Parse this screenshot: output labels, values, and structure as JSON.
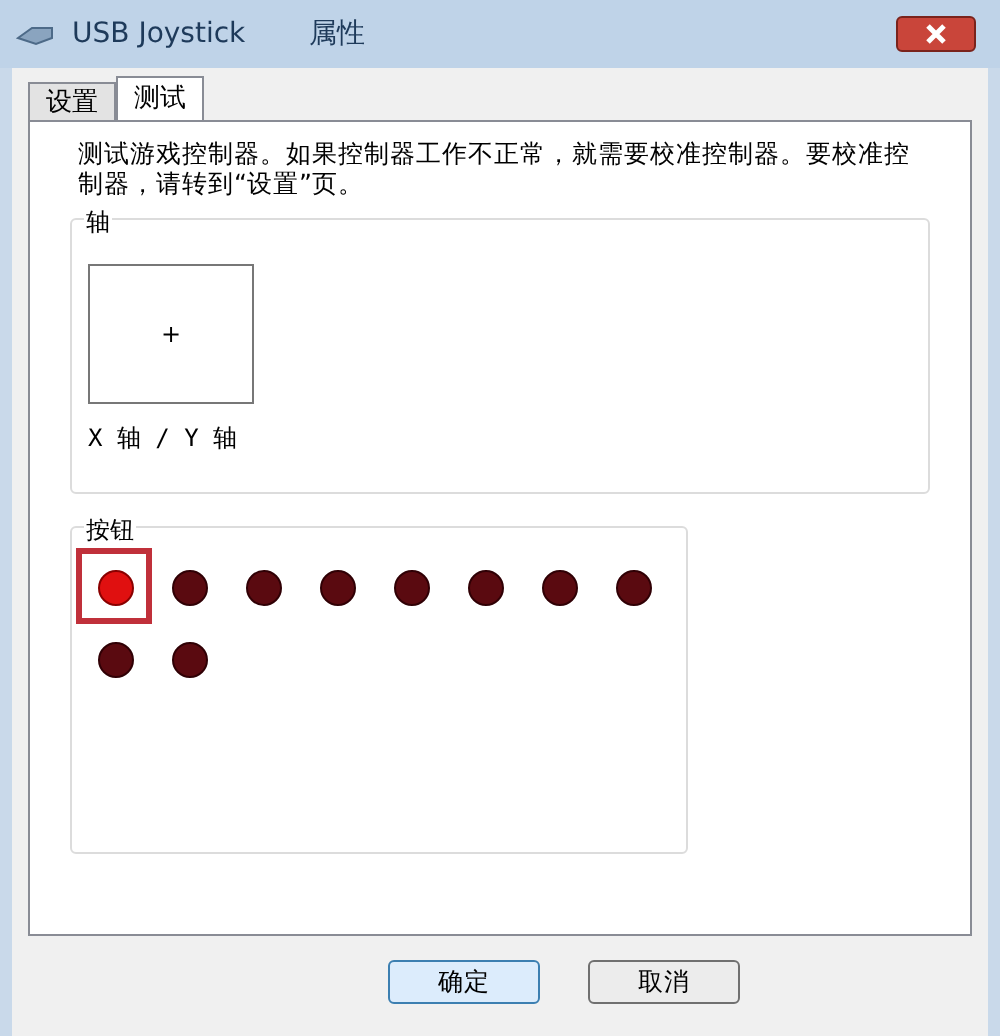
{
  "window": {
    "title": "USB Joystick",
    "subtitle": "属性"
  },
  "tabs": [
    {
      "label": "设置",
      "selected": false
    },
    {
      "label": "测试",
      "selected": true
    }
  ],
  "description": "测试游戏控制器。如果控制器工作不正常，就需要校准控制器。要校准控制器，请转到“设置”页。",
  "axes": {
    "title": "轴",
    "crosshair": "+",
    "label": "X 轴 / Y 轴"
  },
  "buttons_group": {
    "title": "按钮",
    "buttons": [
      {
        "pressed": true,
        "highlighted": true
      },
      {
        "pressed": false,
        "highlighted": false
      },
      {
        "pressed": false,
        "highlighted": false
      },
      {
        "pressed": false,
        "highlighted": false
      },
      {
        "pressed": false,
        "highlighted": false
      },
      {
        "pressed": false,
        "highlighted": false
      },
      {
        "pressed": false,
        "highlighted": false
      },
      {
        "pressed": false,
        "highlighted": false
      },
      {
        "pressed": false,
        "highlighted": false
      },
      {
        "pressed": false,
        "highlighted": false
      }
    ]
  },
  "dialog_buttons": [
    {
      "label": "确定",
      "default": true
    },
    {
      "label": "取消",
      "default": false
    }
  ]
}
